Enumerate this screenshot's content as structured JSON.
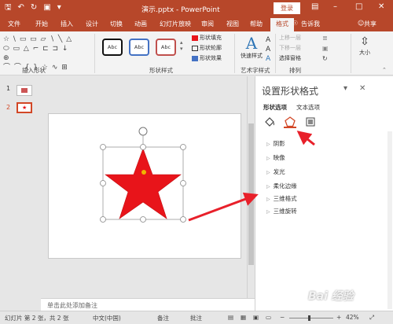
{
  "titlebar": {
    "title": "演示.pptx - PowerPoint",
    "login": "登录",
    "icons": [
      "save-icon",
      "undo-icon",
      "redo-icon",
      "present-icon"
    ]
  },
  "tabs": [
    "文件",
    "开始",
    "插入",
    "设计",
    "切换",
    "动画",
    "幻灯片放映",
    "审阅",
    "视图",
    "帮助",
    "格式"
  ],
  "tell_me": "告诉我",
  "share": "共享",
  "ribbon": {
    "insert_shapes": "插入形状",
    "shape_styles": "形状样式",
    "style_sample": "Abc",
    "fill": "形状填充",
    "outline": "形状轮廓",
    "effects": "形状效果",
    "quick_styles": "快速样式",
    "wordart": "艺术字样式",
    "bring_forward": "上移一层",
    "send_backward": "下移一层",
    "selection_pane": "选择窗格",
    "arrange": "排列",
    "size": "大小"
  },
  "slides": [
    {
      "num": "1"
    },
    {
      "num": "2"
    }
  ],
  "notes_placeholder": "单击此处添加备注",
  "pane": {
    "title": "设置形状格式",
    "tab_shape": "形状选项",
    "tab_text": "文本选项",
    "properties": [
      "阴影",
      "映像",
      "发光",
      "柔化边缘",
      "三维格式",
      "三维旋转"
    ]
  },
  "status": {
    "slide_info": "幻灯片 第 2 张，共 2 张",
    "language": "中文(中国)",
    "notes": "备注",
    "comments": "批注",
    "zoom": "42%"
  },
  "watermark": "Bai 经验",
  "colors": {
    "accent": "#b7472a",
    "star": "#e8141a",
    "arrow": "#e8202a"
  }
}
